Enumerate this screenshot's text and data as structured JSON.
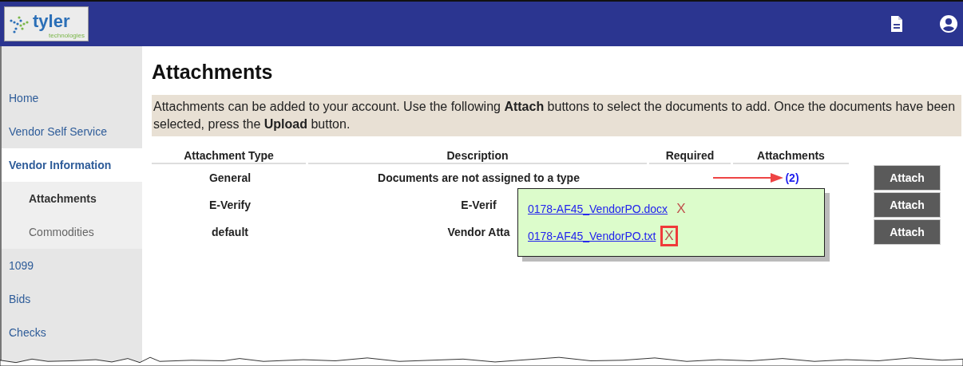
{
  "header": {
    "logo": {
      "name": "tyler",
      "tagline": "technologies"
    }
  },
  "sidebar": {
    "items": [
      {
        "label": "Home",
        "selected": false
      },
      {
        "label": "Vendor Self Service",
        "selected": false
      },
      {
        "label": "Vendor Information",
        "selected": true,
        "children": [
          {
            "label": "Attachments",
            "selected": true
          },
          {
            "label": "Commodities",
            "selected": false
          }
        ]
      },
      {
        "label": "1099",
        "selected": false
      },
      {
        "label": "Bids",
        "selected": false
      },
      {
        "label": "Checks",
        "selected": false
      }
    ]
  },
  "page": {
    "title": "Attachments",
    "info": "Attachments can be added to your account. Use the following **Attach** buttons to select the documents to add. Once the documents have been selected, press the **Upload** button."
  },
  "table": {
    "columns": [
      "Attachment Type",
      "Description",
      "Required",
      "Attachments"
    ],
    "rows": [
      {
        "type": "General",
        "description": "Documents are not assigned to a type",
        "attachments": "(2)",
        "button": "Attach"
      },
      {
        "type": "E-Verify",
        "description": "E-Verif",
        "button": "Attach"
      },
      {
        "type": "default",
        "description": "Vendor Atta",
        "button": "Attach"
      }
    ]
  },
  "popup": {
    "files": [
      {
        "name": "0178-AF45_VendorPO.docx",
        "delete": "X",
        "highlighted": false
      },
      {
        "name": "0178-AF45_VendorPO.txt",
        "delete": "X",
        "highlighted": true
      }
    ]
  }
}
